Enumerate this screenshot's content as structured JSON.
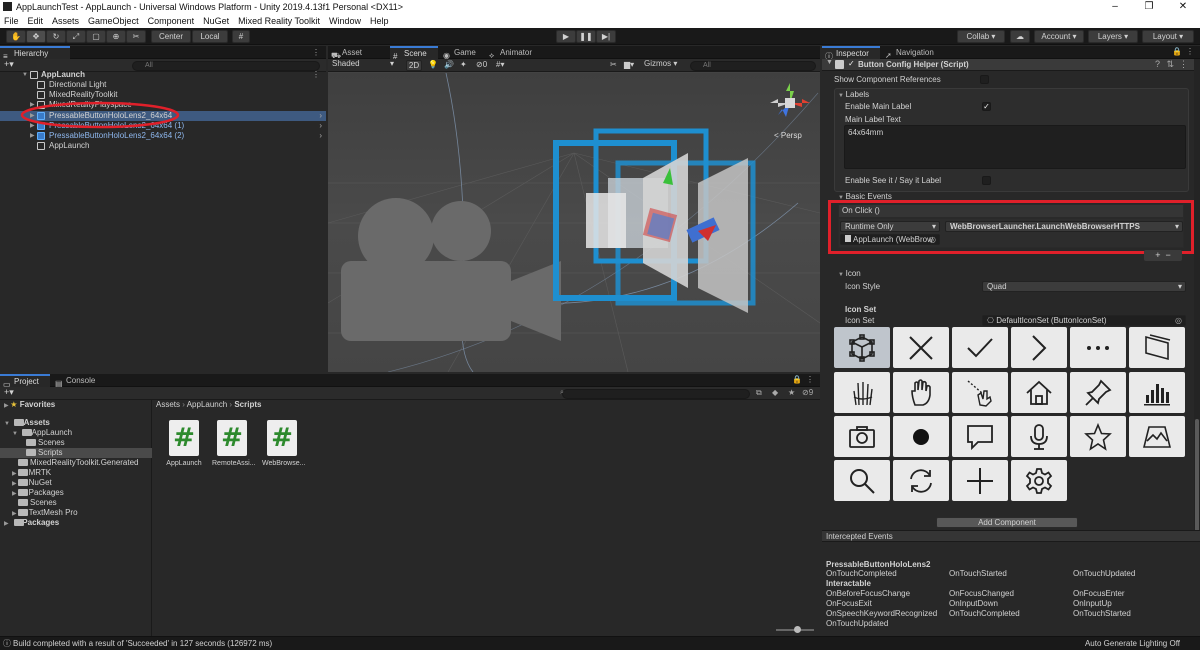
{
  "window": {
    "title": "AppLaunchTest - AppLaunch - Universal Windows Platform - Unity 2019.4.13f1 Personal <DX11>",
    "controls": [
      "–",
      "❐",
      "✕"
    ]
  },
  "menu": [
    "File",
    "Edit",
    "Assets",
    "GameObject",
    "Component",
    "NuGet",
    "Mixed Reality Toolkit",
    "Window",
    "Help"
  ],
  "toolbar": {
    "pivot": "Center",
    "space": "Local",
    "collab": "Collab ▾",
    "account": "Account",
    "layers": "Layers",
    "layout": "Layout"
  },
  "hierarchy": {
    "tab": "Hierarchy",
    "search_placeholder": "All",
    "items": [
      {
        "label": "AppLaunch",
        "bold": true
      },
      {
        "label": "Directional Light"
      },
      {
        "label": "MixedRealityToolkit"
      },
      {
        "label": "MixedRealityPlayspace"
      },
      {
        "label": "PressableButtonHoloLens2_64x64",
        "selected": true
      },
      {
        "label": "PressableButtonHoloLens2_64x64 (1)"
      },
      {
        "label": "PressableButtonHoloLens2_64x64 (2)"
      },
      {
        "label": "AppLaunch"
      }
    ],
    "annotation_color": "#e0202a"
  },
  "scene": {
    "tabs": [
      "Asset Store",
      "Scene",
      "Game",
      "Animator"
    ],
    "active_tab": "Scene",
    "shading": "Shaded",
    "mode2d": "2D",
    "fx_count": "0",
    "gizmos": "Gizmos",
    "search_placeholder": "All",
    "persp_label": "< Persp",
    "highlight_color": "#1e8fd0"
  },
  "project": {
    "tabs": [
      "Project",
      "Console"
    ],
    "favorites": "Favorites",
    "tree": [
      {
        "label": "Assets",
        "bold": true
      },
      {
        "label": "AppLaunch"
      },
      {
        "label": "Scenes"
      },
      {
        "label": "Scripts",
        "selected": true
      },
      {
        "label": "MixedRealityToolkit.Generated"
      },
      {
        "label": "MRTK"
      },
      {
        "label": "NuGet"
      },
      {
        "label": "Packages"
      },
      {
        "label": "Scenes"
      },
      {
        "label": "TextMesh Pro"
      },
      {
        "label": "Packages",
        "bold": true
      }
    ],
    "breadcrumb": [
      "Assets",
      "AppLaunch",
      "Scripts"
    ],
    "assets": [
      "AppLaunch",
      "RemoteAssi...",
      "WebBrowse..."
    ],
    "hidden_count": "9"
  },
  "inspector": {
    "tabs": [
      "Inspector",
      "Navigation"
    ],
    "component_title": "Button Config Helper (Script)",
    "show_refs": "Show Component References",
    "labels_header": "Labels",
    "enable_main_label": "Enable Main Label",
    "main_label_text_label": "Main Label Text",
    "main_label_text": "64x64mm",
    "enable_see_it": "Enable See it / Say it Label",
    "basic_events": "Basic Events",
    "on_click": "On Click ()",
    "runtime": "Runtime Only",
    "function": "WebBrowserLauncher.LaunchWebBrowserHTTPS",
    "target": "AppLaunch (WebBrow",
    "icon_header": "Icon",
    "icon_style_label": "Icon Style",
    "icon_style": "Quad",
    "icon_set_header": "Icon Set",
    "icon_set_label": "Icon Set",
    "icon_set": "DefaultIconSet (ButtonIconSet)",
    "icons": [
      "cube-icon",
      "close-icon",
      "check-icon",
      "chevron-right-icon",
      "more-icon",
      "panel-icon",
      "hand-ray-icon",
      "hand-icon",
      "pointer-icon",
      "home-icon",
      "pin-icon",
      "chart-icon",
      "camera-icon",
      "record-icon",
      "chat-icon",
      "microphone-icon",
      "star-icon",
      "map-icon",
      "search-icon",
      "refresh-icon",
      "plus-icon",
      "gear-icon"
    ],
    "add_component": "Add Component",
    "intercepted": "Intercepted Events",
    "object_name": "PressableButtonHoloLens2",
    "col1": [
      "OnTouchCompleted",
      "Interactable",
      "OnBeforeFocusChange",
      "OnFocusExit",
      "OnSpeechKeywordRecognized",
      "OnTouchUpdated"
    ],
    "col2": [
      "OnTouchStarted",
      "",
      "OnFocusChanged",
      "OnInputDown",
      "OnTouchCompleted"
    ],
    "col3": [
      "OnTouchUpdated",
      "",
      "OnFocusEnter",
      "OnInputUp",
      "OnTouchStarted"
    ],
    "annotation_color": "#e0202a"
  },
  "status": {
    "message": "Build completed with a result of 'Succeeded' in 127 seconds (126972 ms)",
    "right": "Auto Generate Lighting Off"
  }
}
